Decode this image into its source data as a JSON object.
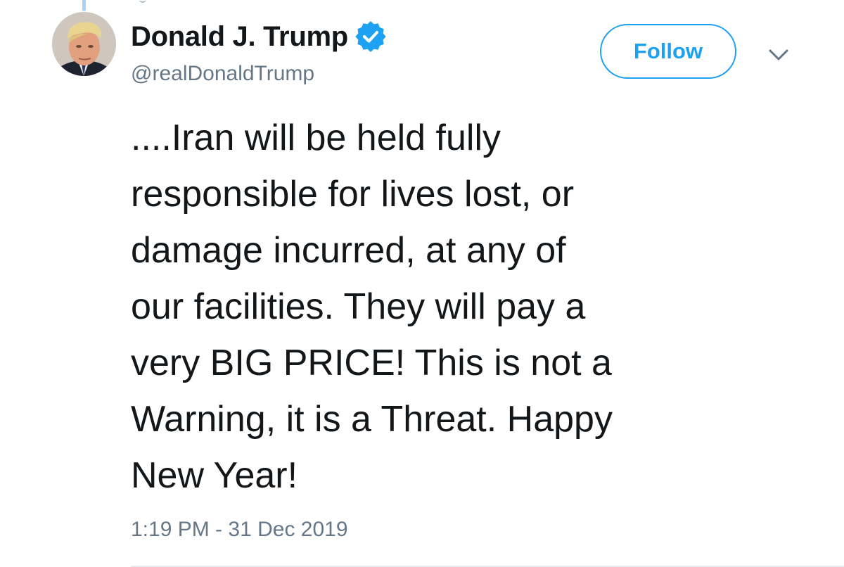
{
  "user": {
    "display_name": "Donald J. Trump",
    "handle": "@realDonaldTrump",
    "verified": true,
    "avatar_icon": "profile-photo"
  },
  "actions": {
    "follow_label": "Follow",
    "menu_icon": "chevron-down-icon"
  },
  "tweet": {
    "lines": [
      "....Iran will be held fully",
      "responsible for lives lost, or",
      "damage incurred, at any of",
      "our facilities. They will pay a",
      "very BIG PRICE! This is not a",
      "Warning, it is a Threat. Happy",
      "New Year!"
    ],
    "timestamp": "1:19 PM - 31 Dec 2019"
  },
  "colors": {
    "accent": "#1da1f2",
    "text_primary": "#14171a",
    "text_secondary": "#657786",
    "thread_line": "#a8d3f5",
    "divider": "#e6ecf0"
  }
}
